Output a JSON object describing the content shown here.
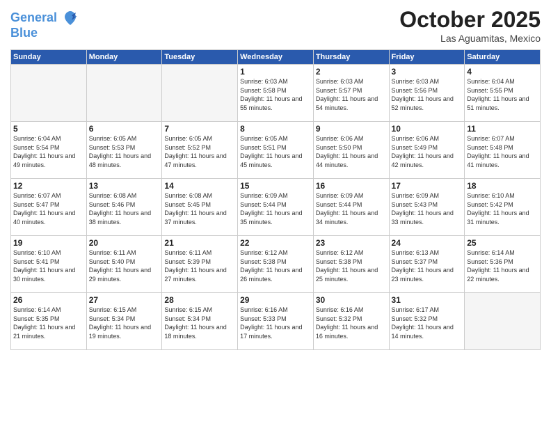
{
  "header": {
    "logo_line1": "General",
    "logo_line2": "Blue",
    "month": "October 2025",
    "location": "Las Aguamitas, Mexico"
  },
  "weekdays": [
    "Sunday",
    "Monday",
    "Tuesday",
    "Wednesday",
    "Thursday",
    "Friday",
    "Saturday"
  ],
  "weeks": [
    [
      {
        "day": "",
        "sunrise": "",
        "sunset": "",
        "daylight": ""
      },
      {
        "day": "",
        "sunrise": "",
        "sunset": "",
        "daylight": ""
      },
      {
        "day": "",
        "sunrise": "",
        "sunset": "",
        "daylight": ""
      },
      {
        "day": "1",
        "sunrise": "Sunrise: 6:03 AM",
        "sunset": "Sunset: 5:58 PM",
        "daylight": "Daylight: 11 hours and 55 minutes."
      },
      {
        "day": "2",
        "sunrise": "Sunrise: 6:03 AM",
        "sunset": "Sunset: 5:57 PM",
        "daylight": "Daylight: 11 hours and 54 minutes."
      },
      {
        "day": "3",
        "sunrise": "Sunrise: 6:03 AM",
        "sunset": "Sunset: 5:56 PM",
        "daylight": "Daylight: 11 hours and 52 minutes."
      },
      {
        "day": "4",
        "sunrise": "Sunrise: 6:04 AM",
        "sunset": "Sunset: 5:55 PM",
        "daylight": "Daylight: 11 hours and 51 minutes."
      }
    ],
    [
      {
        "day": "5",
        "sunrise": "Sunrise: 6:04 AM",
        "sunset": "Sunset: 5:54 PM",
        "daylight": "Daylight: 11 hours and 49 minutes."
      },
      {
        "day": "6",
        "sunrise": "Sunrise: 6:05 AM",
        "sunset": "Sunset: 5:53 PM",
        "daylight": "Daylight: 11 hours and 48 minutes."
      },
      {
        "day": "7",
        "sunrise": "Sunrise: 6:05 AM",
        "sunset": "Sunset: 5:52 PM",
        "daylight": "Daylight: 11 hours and 47 minutes."
      },
      {
        "day": "8",
        "sunrise": "Sunrise: 6:05 AM",
        "sunset": "Sunset: 5:51 PM",
        "daylight": "Daylight: 11 hours and 45 minutes."
      },
      {
        "day": "9",
        "sunrise": "Sunrise: 6:06 AM",
        "sunset": "Sunset: 5:50 PM",
        "daylight": "Daylight: 11 hours and 44 minutes."
      },
      {
        "day": "10",
        "sunrise": "Sunrise: 6:06 AM",
        "sunset": "Sunset: 5:49 PM",
        "daylight": "Daylight: 11 hours and 42 minutes."
      },
      {
        "day": "11",
        "sunrise": "Sunrise: 6:07 AM",
        "sunset": "Sunset: 5:48 PM",
        "daylight": "Daylight: 11 hours and 41 minutes."
      }
    ],
    [
      {
        "day": "12",
        "sunrise": "Sunrise: 6:07 AM",
        "sunset": "Sunset: 5:47 PM",
        "daylight": "Daylight: 11 hours and 40 minutes."
      },
      {
        "day": "13",
        "sunrise": "Sunrise: 6:08 AM",
        "sunset": "Sunset: 5:46 PM",
        "daylight": "Daylight: 11 hours and 38 minutes."
      },
      {
        "day": "14",
        "sunrise": "Sunrise: 6:08 AM",
        "sunset": "Sunset: 5:45 PM",
        "daylight": "Daylight: 11 hours and 37 minutes."
      },
      {
        "day": "15",
        "sunrise": "Sunrise: 6:09 AM",
        "sunset": "Sunset: 5:44 PM",
        "daylight": "Daylight: 11 hours and 35 minutes."
      },
      {
        "day": "16",
        "sunrise": "Sunrise: 6:09 AM",
        "sunset": "Sunset: 5:44 PM",
        "daylight": "Daylight: 11 hours and 34 minutes."
      },
      {
        "day": "17",
        "sunrise": "Sunrise: 6:09 AM",
        "sunset": "Sunset: 5:43 PM",
        "daylight": "Daylight: 11 hours and 33 minutes."
      },
      {
        "day": "18",
        "sunrise": "Sunrise: 6:10 AM",
        "sunset": "Sunset: 5:42 PM",
        "daylight": "Daylight: 11 hours and 31 minutes."
      }
    ],
    [
      {
        "day": "19",
        "sunrise": "Sunrise: 6:10 AM",
        "sunset": "Sunset: 5:41 PM",
        "daylight": "Daylight: 11 hours and 30 minutes."
      },
      {
        "day": "20",
        "sunrise": "Sunrise: 6:11 AM",
        "sunset": "Sunset: 5:40 PM",
        "daylight": "Daylight: 11 hours and 29 minutes."
      },
      {
        "day": "21",
        "sunrise": "Sunrise: 6:11 AM",
        "sunset": "Sunset: 5:39 PM",
        "daylight": "Daylight: 11 hours and 27 minutes."
      },
      {
        "day": "22",
        "sunrise": "Sunrise: 6:12 AM",
        "sunset": "Sunset: 5:38 PM",
        "daylight": "Daylight: 11 hours and 26 minutes."
      },
      {
        "day": "23",
        "sunrise": "Sunrise: 6:12 AM",
        "sunset": "Sunset: 5:38 PM",
        "daylight": "Daylight: 11 hours and 25 minutes."
      },
      {
        "day": "24",
        "sunrise": "Sunrise: 6:13 AM",
        "sunset": "Sunset: 5:37 PM",
        "daylight": "Daylight: 11 hours and 23 minutes."
      },
      {
        "day": "25",
        "sunrise": "Sunrise: 6:14 AM",
        "sunset": "Sunset: 5:36 PM",
        "daylight": "Daylight: 11 hours and 22 minutes."
      }
    ],
    [
      {
        "day": "26",
        "sunrise": "Sunrise: 6:14 AM",
        "sunset": "Sunset: 5:35 PM",
        "daylight": "Daylight: 11 hours and 21 minutes."
      },
      {
        "day": "27",
        "sunrise": "Sunrise: 6:15 AM",
        "sunset": "Sunset: 5:34 PM",
        "daylight": "Daylight: 11 hours and 19 minutes."
      },
      {
        "day": "28",
        "sunrise": "Sunrise: 6:15 AM",
        "sunset": "Sunset: 5:34 PM",
        "daylight": "Daylight: 11 hours and 18 minutes."
      },
      {
        "day": "29",
        "sunrise": "Sunrise: 6:16 AM",
        "sunset": "Sunset: 5:33 PM",
        "daylight": "Daylight: 11 hours and 17 minutes."
      },
      {
        "day": "30",
        "sunrise": "Sunrise: 6:16 AM",
        "sunset": "Sunset: 5:32 PM",
        "daylight": "Daylight: 11 hours and 16 minutes."
      },
      {
        "day": "31",
        "sunrise": "Sunrise: 6:17 AM",
        "sunset": "Sunset: 5:32 PM",
        "daylight": "Daylight: 11 hours and 14 minutes."
      },
      {
        "day": "",
        "sunrise": "",
        "sunset": "",
        "daylight": ""
      }
    ]
  ]
}
